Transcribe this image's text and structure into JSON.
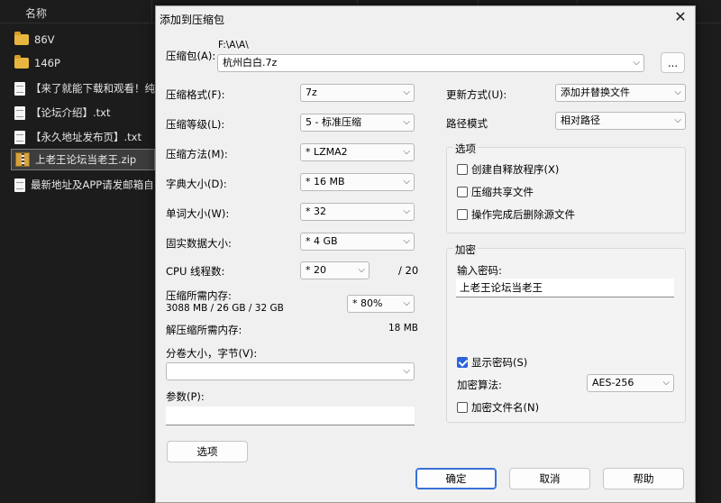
{
  "explorer": {
    "column_name": "名称",
    "files": [
      {
        "name": "86V",
        "type": "folder"
      },
      {
        "name": "146P",
        "type": "folder"
      },
      {
        "name": "【来了就能下载和观看！纯",
        "type": "doc"
      },
      {
        "name": "【论坛介绍】.txt",
        "type": "doc"
      },
      {
        "name": "【永久地址发布页】.txt",
        "type": "doc"
      },
      {
        "name": "上老王论坛当老王.zip",
        "type": "zip",
        "selected": true
      },
      {
        "name": "最新地址及APP请发邮箱自",
        "type": "doc"
      }
    ]
  },
  "dialog": {
    "title": "添加到压缩包",
    "archive": {
      "label": "压缩包(A):",
      "path": "F:\\A\\A\\",
      "filename": "杭州白白.7z",
      "browse": "..."
    },
    "left": {
      "format_label": "压缩格式(F):",
      "format_value": "7z",
      "level_label": "压缩等级(L):",
      "level_value": "5 - 标准压缩",
      "method_label": "压缩方法(M):",
      "method_value": "* LZMA2",
      "dict_label": "字典大小(D):",
      "dict_value": "* 16 MB",
      "word_label": "单词大小(W):",
      "word_value": "* 32",
      "solid_label": "固实数据大小:",
      "solid_value": "* 4 GB",
      "threads_label": "CPU 线程数:",
      "threads_value": "* 20",
      "threads_max": "/ 20",
      "mem_label": "压缩所需内存:",
      "mem_detail": "3088 MB / 26 GB / 32 GB",
      "mem_value": "* 80%",
      "decomp_label": "解压缩所需内存:",
      "decomp_value": "18 MB",
      "split_label": "分卷大小，字节(V):",
      "split_value": "",
      "params_label": "参数(P):",
      "params_value": "",
      "options_button": "选项"
    },
    "right": {
      "update_label": "更新方式(U):",
      "update_value": "添加并替换文件",
      "path_label": "路径模式",
      "path_value": "相对路径",
      "options_group": "选项",
      "opt_sfx": "创建自释放程序(X)",
      "opt_shared": "压缩共享文件",
      "opt_delete": "操作完成后删除源文件",
      "encrypt_group": "加密",
      "password_label": "输入密码:",
      "password_value": "上老王论坛当老王",
      "show_password": "显示密码(S)",
      "enc_method_label": "加密算法:",
      "enc_method_value": "AES-256",
      "encrypt_names": "加密文件名(N)"
    },
    "buttons": {
      "ok": "确定",
      "cancel": "取消",
      "help": "帮助"
    }
  }
}
